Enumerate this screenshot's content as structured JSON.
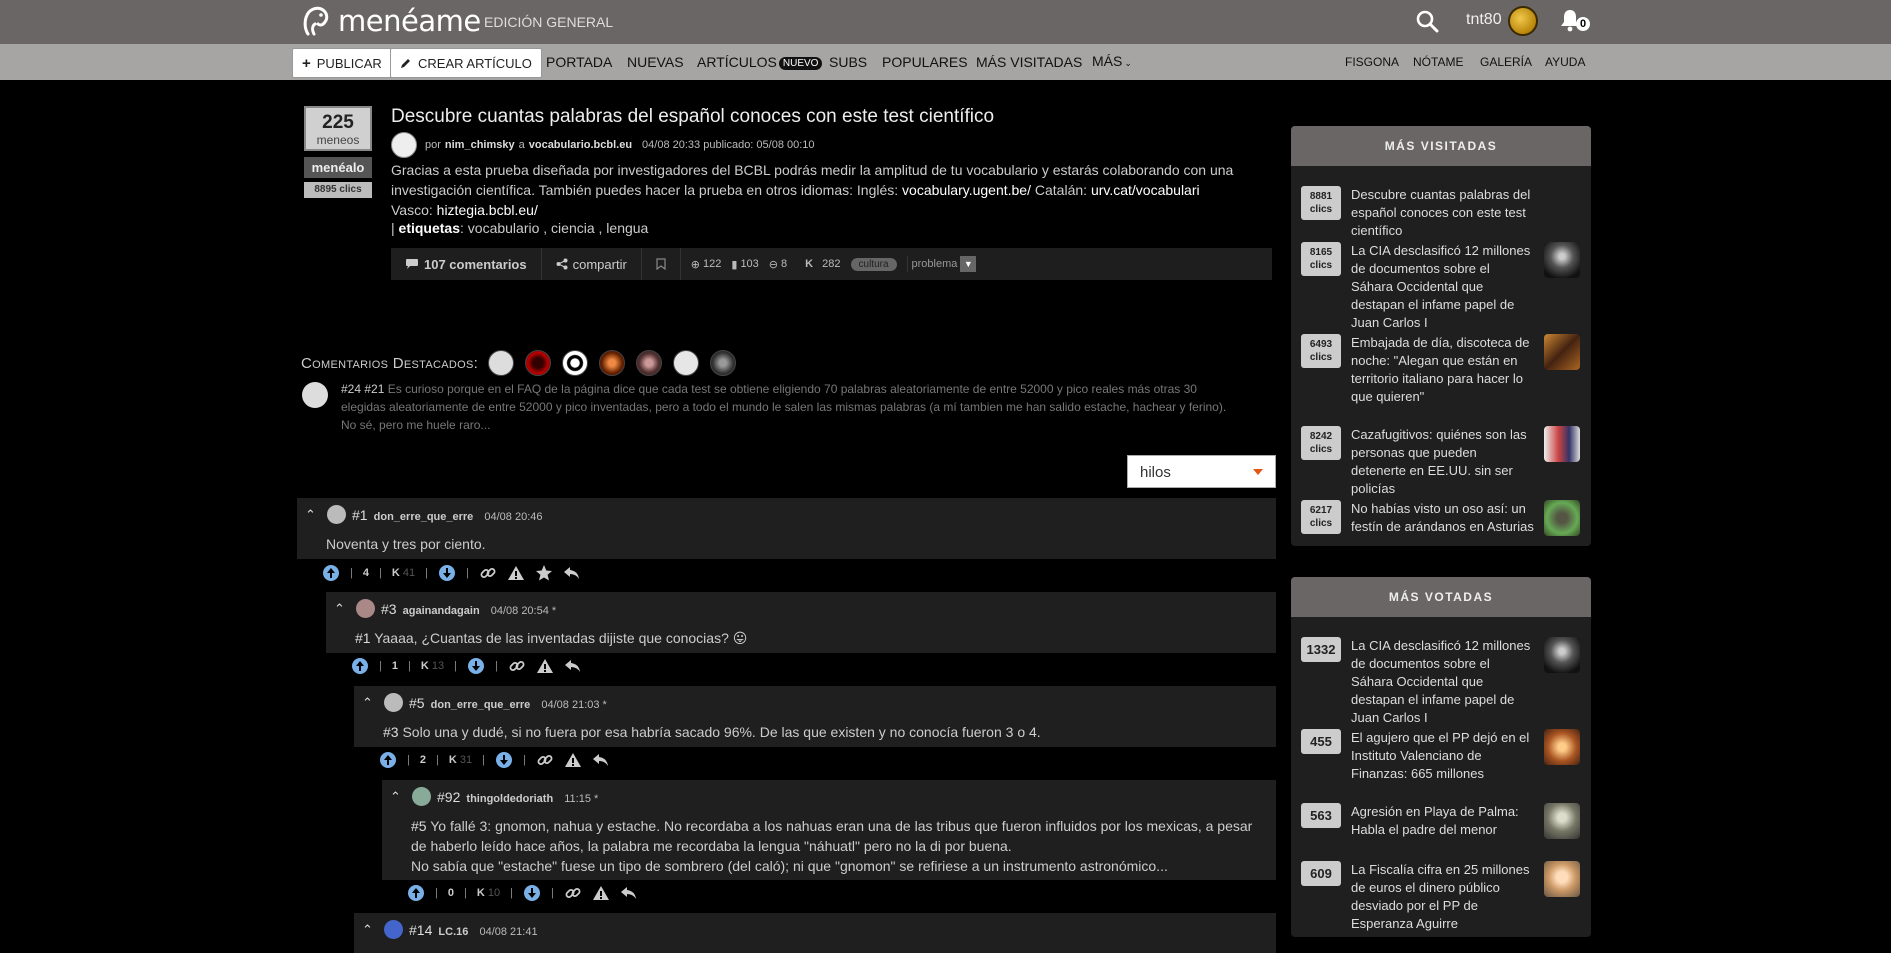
{
  "header": {
    "logo_text": "menéame",
    "edition": "EDICIÓN GENERAL",
    "username": "tnt80",
    "notifications_count": "0"
  },
  "nav": {
    "publicar": "PUBLICAR",
    "crear_articulo": "CREAR ARTÍCULO",
    "portada": "PORTADA",
    "nuevas": "NUEVAS",
    "articulos": "ARTÍCULOS",
    "nuevo_badge": "NUEVO",
    "subs": "SUBS",
    "populares": "POPULARES",
    "mas_visitadas": "MÁS VISITADAS",
    "mas": "MÁS",
    "right": [
      "FISGONA",
      "NÓTAME",
      "GALERÍA",
      "AYUDA"
    ]
  },
  "story": {
    "votes": "225",
    "votes_unit": "meneos",
    "menealo": "menéalo",
    "clics": "8895 clics",
    "title": "Descubre cuantas palabras del español conoces con este test científico",
    "meta_por": "por",
    "author": "nim_chimsky",
    "meta_a": "a",
    "domain": "vocabulario.bcbl.eu",
    "dates": "04/08 20:33 publicado: 05/08 00:10",
    "body_1": "Gracias a esta prueba diseñada por investigadores del BCBL podrás medir la amplitud de tu vocabulario y estarás colaborando con una investigación científica. También puedes hacer la prueba en otros idiomas: Inglés:",
    "link_en": "vocabulary.ugent.be/",
    "body_ca": "Catalán:",
    "link_ca": "urv.cat/vocabulari",
    "body_eu": "Vasco:",
    "link_eu": "hiztegia.bcbl.eu/",
    "tags_label": "etiquetas",
    "tags": "vocabulario , ciencia , lengua",
    "comments": "107 comentarios",
    "share": "compartir",
    "stat_up": "122",
    "stat_users": "103",
    "stat_down": "8",
    "karma_label": "K",
    "karma": "282",
    "category": "cultura",
    "problem": "problema"
  },
  "destacados": {
    "label": "Comentarios Destacados:",
    "ref": "#24 #21",
    "text": "Es curioso porque en el FAQ de la página dice que cada test se obtiene eligiendo 70 palabras aleatoriamente de entre 52000 y pico reales más otras 30 elegidas aleatoriamente de entre 52000 y pico inventadas, pero a todo el mundo le salen las mismas palabras (a mí tambien me han salido estache, hachear y ferino). No sé, pero me huele raro..."
  },
  "order": {
    "selected": "hilos"
  },
  "comments": [
    {
      "num": "#1",
      "user": "don_erre_que_erre",
      "date": "04/08 20:46",
      "text": "Noventa y tres por ciento.",
      "votes": "4",
      "karma": "41"
    },
    {
      "num": "#3",
      "user": "againandagain",
      "date": "04/08 20:54 *",
      "ref": "#1",
      "text": "Yaaaa, ¿Cuantas de las inventadas dijiste que conocias? 😛",
      "votes": "1",
      "karma": "13"
    },
    {
      "num": "#5",
      "user": "don_erre_que_erre",
      "date": "04/08 21:03 *",
      "ref": "#3",
      "text": "Solo una y dudé, si no fuera por esa habría sacado 96%. De las que existen y no conocía fueron 3 o 4.",
      "votes": "2",
      "karma": "31"
    },
    {
      "num": "#92",
      "user": "thingoldedoriath",
      "date": "11:15 *",
      "ref": "#5",
      "text_1": "Yo fallé 3: gnomon, nahua y estache. No recordaba a los nahuas eran una de las tribus que fueron influidos por los mexicas, a pesar de haberlo leído hace años, la palabra me recordaba la lengua \"náhuatl\" pero no la di por buena.",
      "text_2": "No sabía que \"estache\" fuese un tipo de sombrero (del caló); ni que \"gnomon\" se refiriese a un instrumento astronómico...",
      "votes": "0",
      "karma": "10"
    },
    {
      "num": "#14",
      "user": "LC.16",
      "date": "04/08 21:41"
    }
  ],
  "k_label": "K",
  "sidebar": {
    "visitadas_title": "MÁS VISITADAS",
    "clics_unit": "clics",
    "visitadas": [
      {
        "clicks": "8881",
        "title": "Descubre cuantas palabras del español conoces con este test científico"
      },
      {
        "clicks": "8165",
        "title": "La CIA desclasificó 12 millones de documentos sobre el Sáhara Occidental que destapan el infame papel de Juan Carlos I"
      },
      {
        "clicks": "6493",
        "title": "Embajada de día, discoteca de noche: \"Alegan que están en territorio italiano para hacer lo que quieren\""
      },
      {
        "clicks": "8242",
        "title": "Cazafugitivos: quiénes son las personas que pueden detenerte en EE.UU. sin ser policías"
      },
      {
        "clicks": "6217",
        "title": "No habías visto un oso así: un festín de arándanos en Asturias"
      }
    ],
    "votadas_title": "MÁS VOTADAS",
    "votadas": [
      {
        "votes": "1332",
        "title": "La CIA desclasificó 12 millones de documentos sobre el Sáhara Occidental que destapan el infame papel de Juan Carlos I"
      },
      {
        "votes": "455",
        "title": "El agujero que el PP dejó en el Instituto Valenciano de Finanzas: 665 millones"
      },
      {
        "votes": "563",
        "title": "Agresión en Playa de Palma: Habla el padre del menor"
      },
      {
        "votes": "609",
        "title": "La Fiscalía cifra en 25 millones de euros el dinero público desviado por el PP de Esperanza Aguirre"
      }
    ]
  }
}
